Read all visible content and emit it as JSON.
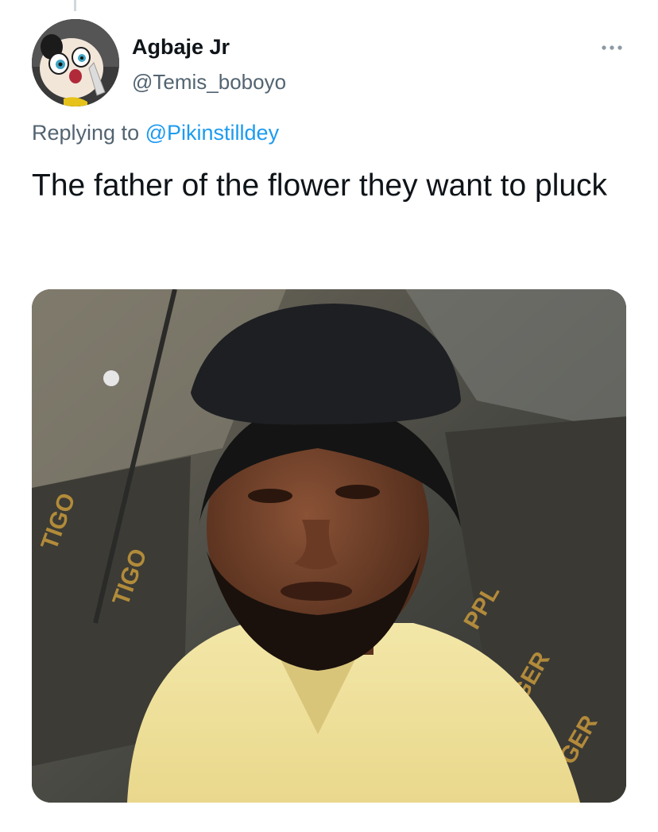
{
  "tweet": {
    "author": {
      "display_name": "Agbaje Jr",
      "handle": "@Temis_boboyo",
      "avatar_icon": "cartoon-character-avatar"
    },
    "more_icon": "more-horizontal-icon",
    "reply_prefix": "Replying to",
    "reply_to_handle": "@Pikinstilldey",
    "text": "The father of the flower they want to pluck",
    "media": {
      "type": "photo"
    }
  },
  "colors": {
    "text": "#0f1419",
    "secondary": "#536471",
    "link": "#1d9bf0"
  }
}
